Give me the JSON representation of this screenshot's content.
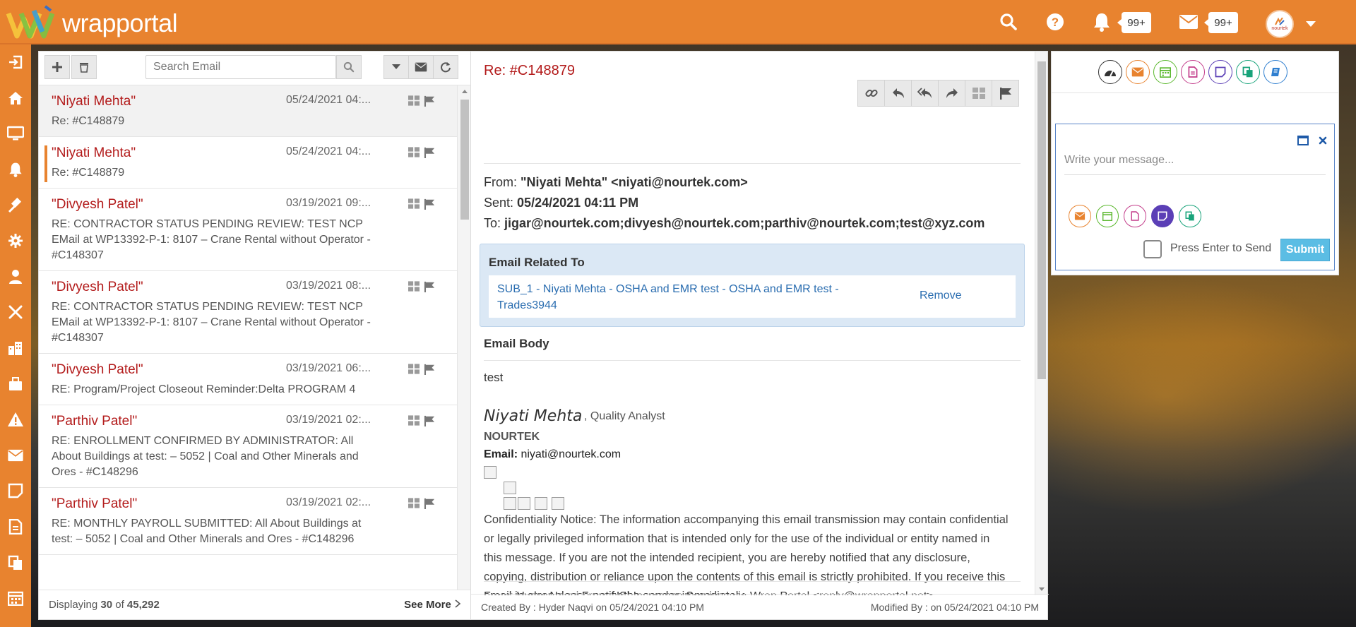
{
  "app": {
    "logo_text": "wrapportal",
    "notifications_count": "99+",
    "messages_count": "99+",
    "avatar_brand": "nourtek"
  },
  "sidebar": {
    "items": [
      {
        "icon": "sign-in-icon"
      },
      {
        "icon": "home-icon"
      },
      {
        "icon": "monitor-icon"
      },
      {
        "icon": "bell-icon"
      },
      {
        "icon": "gavel-icon"
      },
      {
        "icon": "gear-icon"
      },
      {
        "icon": "user-icon"
      },
      {
        "icon": "tools-icon"
      },
      {
        "icon": "building-icon"
      },
      {
        "icon": "toolbox-icon"
      },
      {
        "icon": "warning-icon"
      },
      {
        "icon": "envelope-icon"
      },
      {
        "icon": "note-icon"
      },
      {
        "icon": "document-icon"
      },
      {
        "icon": "copy-icon"
      },
      {
        "icon": "calendar-icon"
      }
    ]
  },
  "email_list": {
    "search_placeholder": "Search Email",
    "items": [
      {
        "from": "\"Niyati Mehta\"",
        "date": "05/24/2021 04:...",
        "subject": "Re: #C148879"
      },
      {
        "from": "\"Niyati Mehta\"",
        "date": "05/24/2021 04:...",
        "subject": "Re: #C148879"
      },
      {
        "from": "\"Divyesh Patel\"",
        "date": "03/19/2021 09:...",
        "subject": "RE: CONTRACTOR STATUS PENDING REVIEW: TEST NCP EMail at WP13392-P-1: 8107 – Crane Rental without Operator - #C148307"
      },
      {
        "from": "\"Divyesh Patel\"",
        "date": "03/19/2021 08:...",
        "subject": "RE: CONTRACTOR STATUS PENDING REVIEW: TEST NCP EMail at WP13392-P-1: 8107 – Crane Rental without Operator - #C148307"
      },
      {
        "from": "\"Divyesh Patel\"",
        "date": "03/19/2021 06:...",
        "subject": "RE: Program/Project Closeout Reminder:Delta PROGRAM 4"
      },
      {
        "from": "\"Parthiv Patel\"",
        "date": "03/19/2021 02:...",
        "subject": "RE: ENROLLMENT CONFIRMED BY ADMINISTRATOR: All About Buildings at test: – 5052 | Coal and Other Minerals and Ores - #C148296"
      },
      {
        "from": "\"Parthiv Patel\"",
        "date": "03/19/2021 02:...",
        "subject": "RE: MONTHLY PAYROLL SUBMITTED: All About Buildings at test: – 5052 | Coal and Other Minerals and Ores - #C148296"
      }
    ],
    "footer_prefix": "Displaying",
    "footer_shown": "30",
    "footer_of": "of",
    "footer_total": "45,292",
    "see_more": "See More"
  },
  "email_detail": {
    "title": "Re: #C148879",
    "from_label": "From:",
    "from_value": "\"Niyati Mehta\" <niyati@nourtek.com>",
    "sent_label": "Sent:",
    "sent_value": "05/24/2021 04:11 PM",
    "to_label": "To:",
    "to_value": "jigar@nourtek.com;divyesh@nourtek.com;parthiv@nourtek.com;test@xyz.com",
    "related_title": "Email Related To",
    "related_link": "SUB_1 - Niyati Mehta - OSHA and EMR test - OSHA and EMR test - Trades3944",
    "remove": "Remove",
    "body_title": "Email Body",
    "body_text": "test",
    "sig_name": "Niyati Mehta",
    "sig_role": ", Quality Analyst",
    "sig_company": "NOURTEK",
    "sig_email_label": "Email:",
    "sig_email": "niyati@nourtek.com",
    "confidentiality": "Confidentiality Notice: The information accompanying this email transmission may contain confidential or legally privileged information that is intended only for the use of the individual or entity named in this message.    If you are not the intended recipient, you are hereby notified that any disclosure, copying, distribution or reliance upon the contents of this email is strictly prohibited.   If you receive this email in error please notify the sender immediately.",
    "forward_line": "From: Hyder Naqvi From USI Insurance Services via Wrap Portal <reply@wrapportal.net>",
    "created_by": "Created By : Hyder Naqvi on 05/24/2021 04:10 PM",
    "modified_by": "Modified By : on 05/24/2021 04:10 PM"
  },
  "chat": {
    "placeholder": "Write your message...",
    "press_enter": "Press Enter to Send",
    "submit": "Submit"
  },
  "colors": {
    "brand_orange": "#e8832f",
    "sender_red": "#b31b1b",
    "link_blue": "#2a6db0"
  }
}
